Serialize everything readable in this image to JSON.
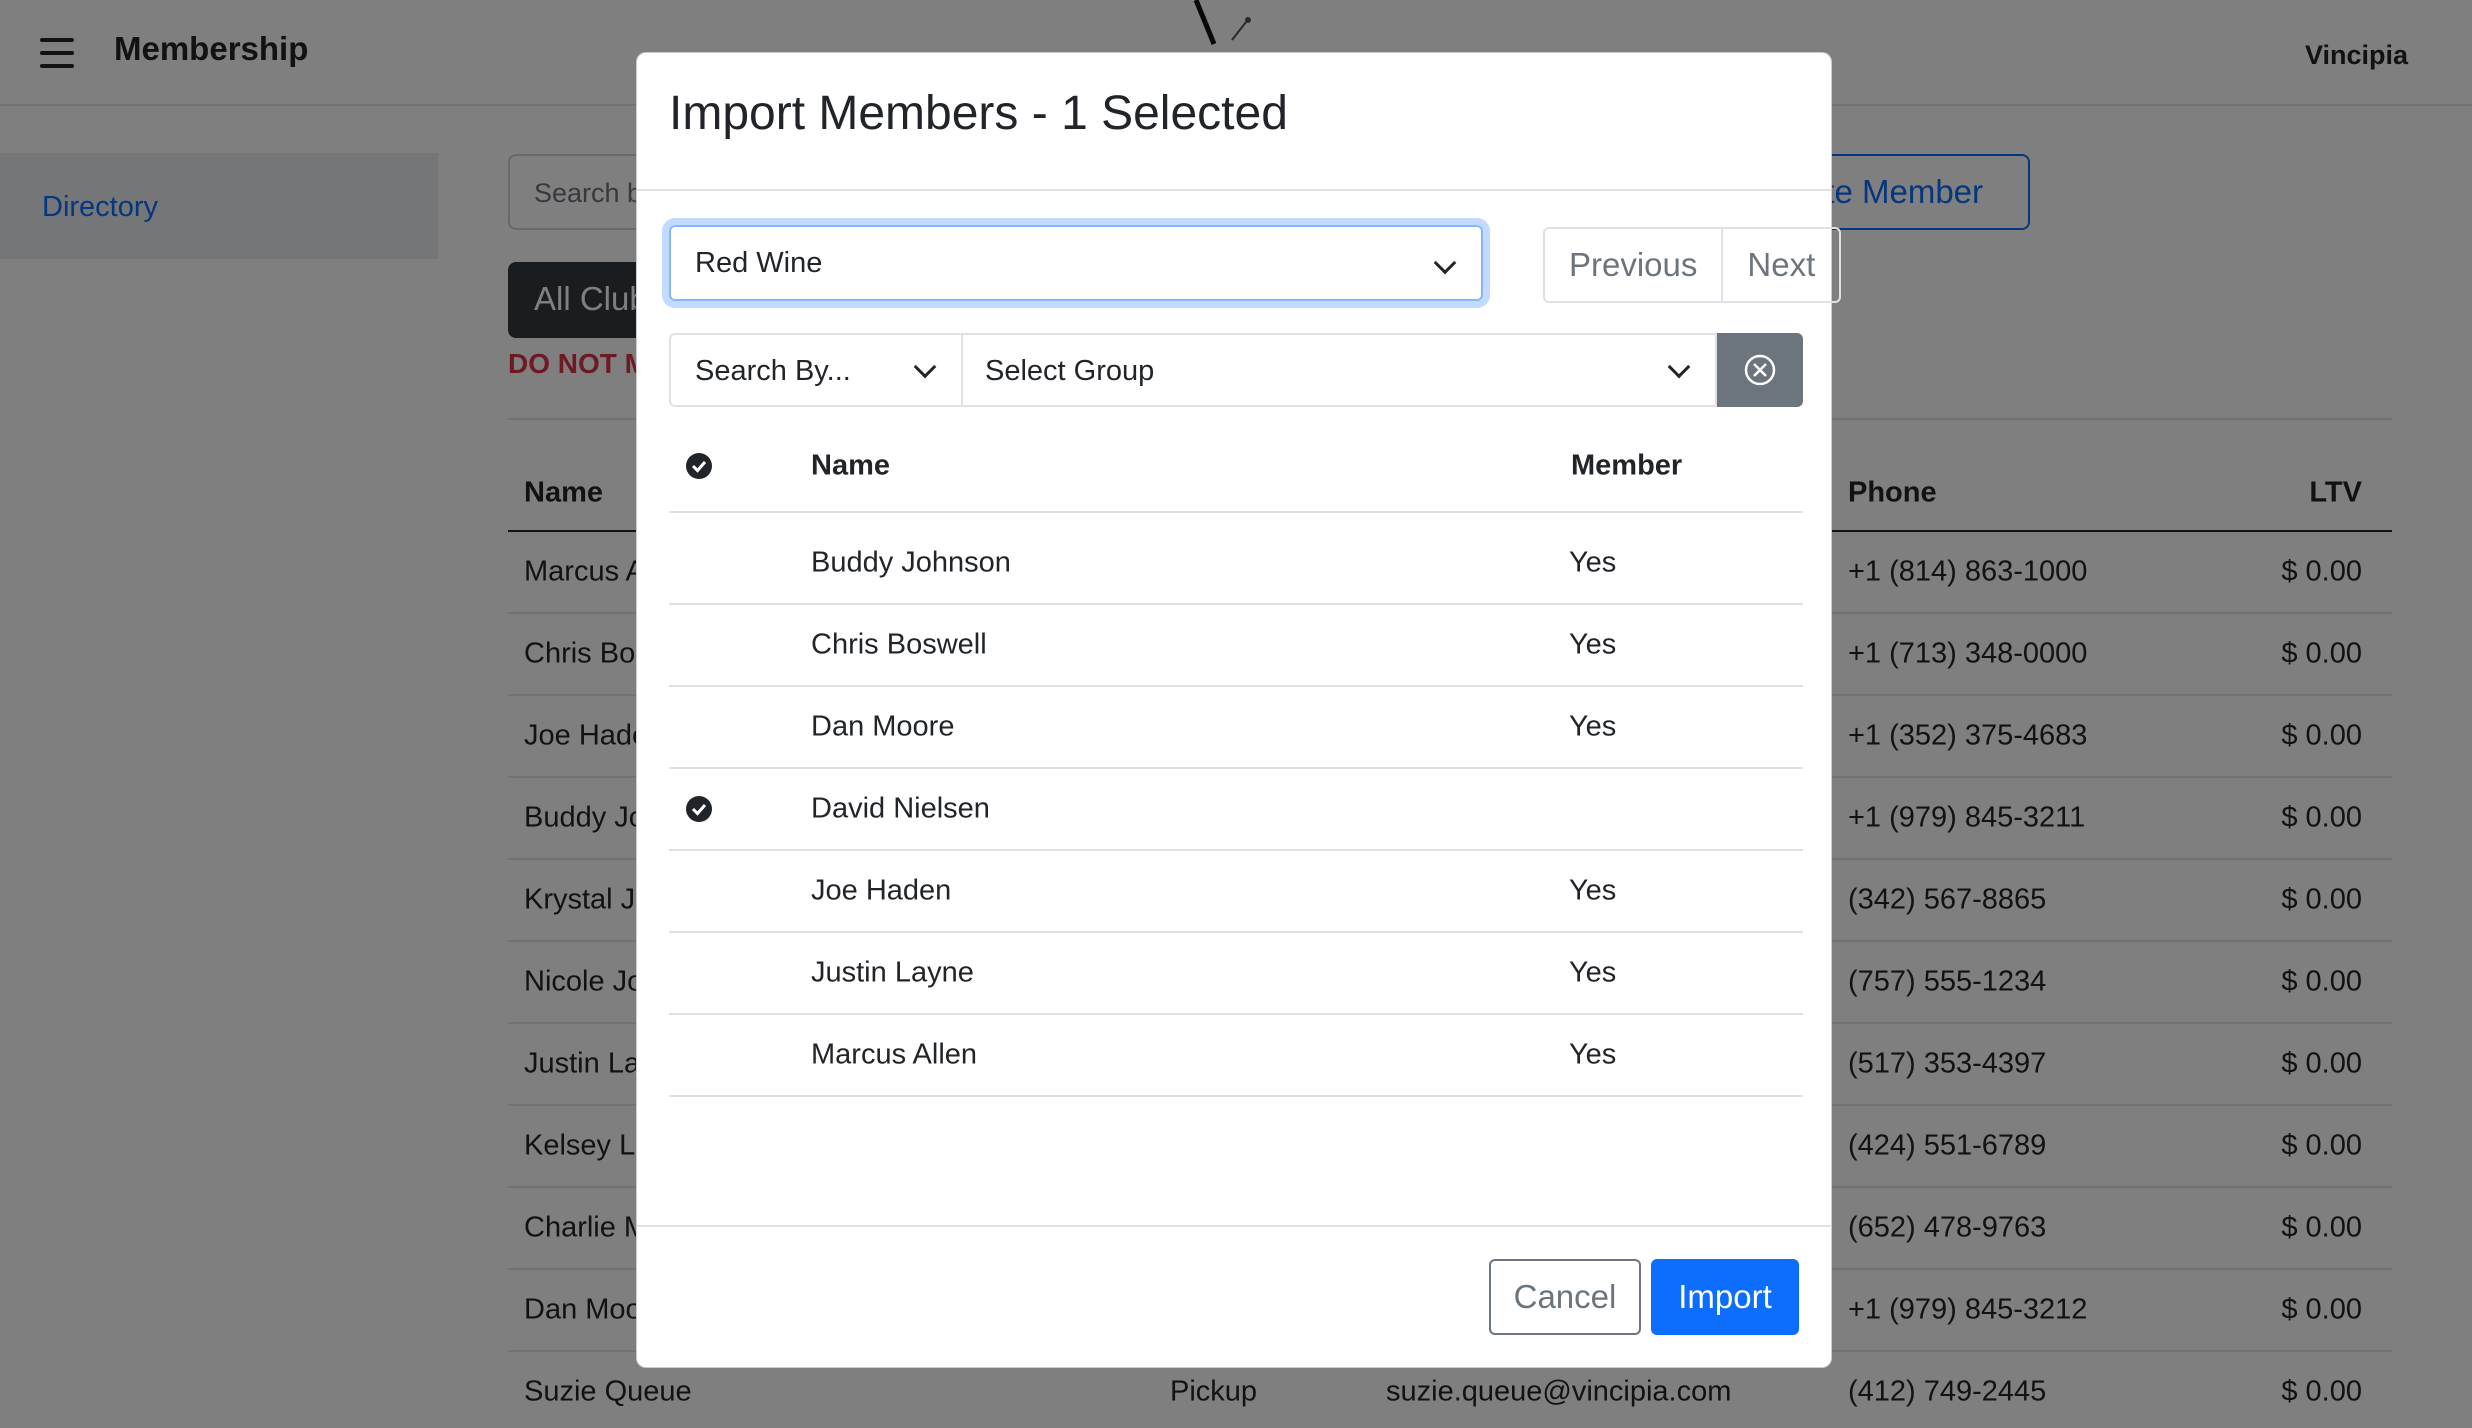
{
  "app": {
    "title": "Membership",
    "org_name": "Vincipia"
  },
  "sidebar": {
    "items": [
      {
        "label": "Directory"
      }
    ]
  },
  "main": {
    "search_placeholder": "Search b",
    "create_button_label": "ate Member",
    "filter_button_label": "All Club",
    "warning_text": "DO NOT M",
    "table": {
      "headers": {
        "name": "Name",
        "phone": "Phone",
        "ltv": "LTV"
      },
      "rows": [
        {
          "name": "Marcus A",
          "pref": "",
          "email": "",
          "phone": "+1 (814) 863-1000",
          "ltv": "$ 0.00"
        },
        {
          "name": "Chris Bos",
          "pref": "",
          "email": "",
          "phone": "+1 (713) 348-0000",
          "ltv": "$ 0.00"
        },
        {
          "name": "Joe Hade",
          "pref": "",
          "email": "",
          "phone": "+1 (352) 375-4683",
          "ltv": "$ 0.00"
        },
        {
          "name": "Buddy Jo",
          "pref": "",
          "email": "",
          "phone": "+1 (979) 845-3211",
          "ltv": "$ 0.00"
        },
        {
          "name": "Krystal J",
          "pref": "",
          "email": "",
          "phone": "(342) 567-8865",
          "ltv": "$ 0.00"
        },
        {
          "name": "Nicole Jo",
          "pref": "",
          "email": "",
          "phone": "(757) 555-1234",
          "ltv": "$ 0.00"
        },
        {
          "name": "Justin La",
          "pref": "",
          "email": "",
          "phone": "(517) 353-4397",
          "ltv": "$ 0.00"
        },
        {
          "name": "Kelsey Le",
          "pref": "",
          "email": "",
          "phone": "(424) 551-6789",
          "ltv": "$ 0.00"
        },
        {
          "name": "Charlie M",
          "pref": "",
          "email": "",
          "phone": "(652) 478-9763",
          "ltv": "$ 0.00"
        },
        {
          "name": "Dan Moo",
          "pref": "",
          "email": "",
          "phone": "+1 (979) 845-3212",
          "ltv": "$ 0.00"
        },
        {
          "name": "Suzie Queue",
          "pref": "Pickup",
          "email": "suzie.queue@vincipia.com",
          "phone": "(412) 749-2445",
          "ltv": "$ 0.00"
        }
      ]
    }
  },
  "modal": {
    "title": "Import Members - 1 Selected",
    "club_select_value": "Red Wine",
    "previous_label": "Previous",
    "next_label": "Next",
    "search_by_value": "Search By...",
    "group_select_value": "Select Group",
    "table": {
      "headers": {
        "name": "Name",
        "member": "Member"
      },
      "rows": [
        {
          "name": "Buddy Johnson",
          "member": "Yes",
          "selected": false
        },
        {
          "name": "Chris Boswell",
          "member": "Yes",
          "selected": false
        },
        {
          "name": "Dan Moore",
          "member": "Yes",
          "selected": false
        },
        {
          "name": "David Nielsen",
          "member": "",
          "selected": true
        },
        {
          "name": "Joe Haden",
          "member": "Yes",
          "selected": false
        },
        {
          "name": "Justin Layne",
          "member": "Yes",
          "selected": false
        },
        {
          "name": "Marcus Allen",
          "member": "Yes",
          "selected": false
        }
      ]
    },
    "cancel_label": "Cancel",
    "import_label": "Import"
  },
  "colors": {
    "primary": "#0d6efd",
    "danger": "#dc3545",
    "dark": "#343a40",
    "secondary": "#6c757d"
  }
}
